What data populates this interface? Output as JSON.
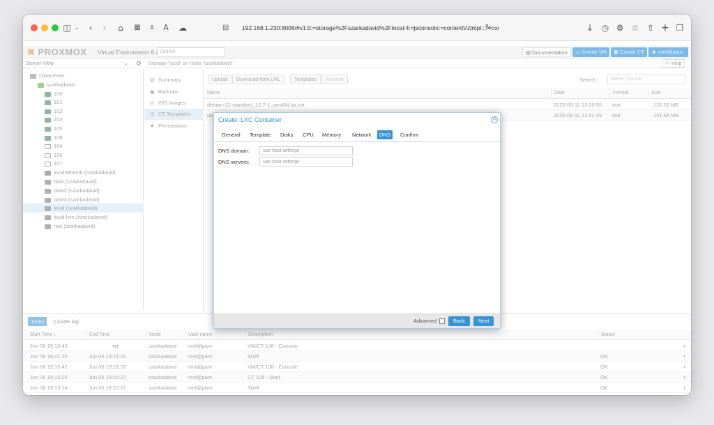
{
  "browser": {
    "url": "192.168.1.230:8006/#v1:0:=storage%2Fszarkadavid%2Flocal:4:=jsconsole:=contentVztmpl::::=con"
  },
  "header": {
    "logo": "PROXMOX",
    "product": "Virtual Environment 8.4.1",
    "search_placeholder": "Search",
    "documentation": "Documentation",
    "create_vm": "Create VM",
    "create_ct": "Create CT",
    "user": "root@pam"
  },
  "tree": {
    "view": "Server View",
    "items": [
      {
        "label": "Datacenter",
        "icon": "datacenter-icon"
      },
      {
        "label": "szarkadavid",
        "icon": "node-icon"
      },
      {
        "label": "100",
        "icon": "container-icon"
      },
      {
        "label": "101",
        "icon": "container-icon"
      },
      {
        "label": "102",
        "icon": "container-icon"
      },
      {
        "label": "103",
        "icon": "container-icon"
      },
      {
        "label": "105",
        "icon": "container-icon"
      },
      {
        "label": "108",
        "icon": "container-icon"
      },
      {
        "label": "104",
        "icon": "vm-icon"
      },
      {
        "label": "106",
        "icon": "vm-icon"
      },
      {
        "label": "107",
        "icon": "vm-icon"
      },
      {
        "label": "localnetwork (szarkadavid)",
        "icon": "network-icon"
      },
      {
        "label": "data (szarkadavid)",
        "icon": "storage-icon"
      },
      {
        "label": "data2 (szarkadavid)",
        "icon": "storage-icon"
      },
      {
        "label": "data3 (szarkadavid)",
        "icon": "storage-icon"
      },
      {
        "label": "local (szarkadavid)",
        "icon": "storage-icon"
      },
      {
        "label": "local-lvm (szarkadavid)",
        "icon": "storage-icon"
      },
      {
        "label": "nas (szarkadavid)",
        "icon": "storage-icon"
      }
    ]
  },
  "breadcrumb": "Storage 'local' on node 'szarkadavid'",
  "help": "Help",
  "nav": {
    "items": [
      {
        "label": "Summary",
        "icon": "summary-icon"
      },
      {
        "label": "Backups",
        "icon": "backup-icon"
      },
      {
        "label": "ISO Images",
        "icon": "disc-icon"
      },
      {
        "label": "CT Templates",
        "icon": "template-icon"
      },
      {
        "label": "Permissions",
        "icon": "unlock-icon"
      }
    ]
  },
  "content": {
    "upload": "Upload",
    "download_url": "Download from URL",
    "templates": "Templates",
    "remove": "Remove",
    "search_label": "Search:",
    "search_placeholder": "Name, Format",
    "columns": [
      "Name",
      "Date",
      "Format",
      "Size"
    ],
    "rows": [
      {
        "name": "debian-12-standard_12.7-1_amd64.tar.zst",
        "date": "2025-05-11 13:20:55",
        "format": "tzst",
        "size": "126.52 MB"
      },
      {
        "name": "ub",
        "date": "2025-05-11 12:51:45",
        "format": "tzst",
        "size": "141.59 MB"
      }
    ]
  },
  "modal": {
    "title": "Create: LXC Container",
    "tabs": [
      "General",
      "Template",
      "Disks",
      "CPU",
      "Memory",
      "Network",
      "DNS",
      "Confirm"
    ],
    "active_tab": "DNS",
    "fields": [
      {
        "label": "DNS domain:",
        "placeholder": "use host settings"
      },
      {
        "label": "DNS servers:",
        "placeholder": "use host settings"
      }
    ],
    "advanced": "Advanced",
    "back": "Back",
    "next": "Next"
  },
  "tasks": {
    "tab_active": "Tasks",
    "tab_other": "Cluster log",
    "columns": [
      "Start Time ↓",
      "End Time",
      "Node",
      "User name",
      "Description",
      "Status"
    ],
    "rows": [
      {
        "start": "Jun 06 19:15:43",
        "end": "",
        "node": "szarkadavid",
        "user": "root@pam",
        "desc": "VM/CT 108 - Console",
        "status": ""
      },
      {
        "start": "Jun 06 19:21:20",
        "end": "Jun 06 19:21:22",
        "node": "szarkadavid",
        "user": "root@pam",
        "desc": "Shell",
        "status": "OK"
      },
      {
        "start": "Jun 06 19:15:42",
        "end": "Jun 06 19:21:20",
        "node": "szarkadavid",
        "user": "root@pam",
        "desc": "VM/CT 108 - Console",
        "status": "OK"
      },
      {
        "start": "Jun 06 19:15:25",
        "end": "Jun 06 19:15:27",
        "node": "szarkadavid",
        "user": "root@pam",
        "desc": "CT 108 - Start",
        "status": "OK"
      },
      {
        "start": "Jun 06 19:13:14",
        "end": "Jun 06 19:15:21",
        "node": "szarkadavid",
        "user": "root@pam",
        "desc": "Shell",
        "status": "OK"
      }
    ]
  }
}
